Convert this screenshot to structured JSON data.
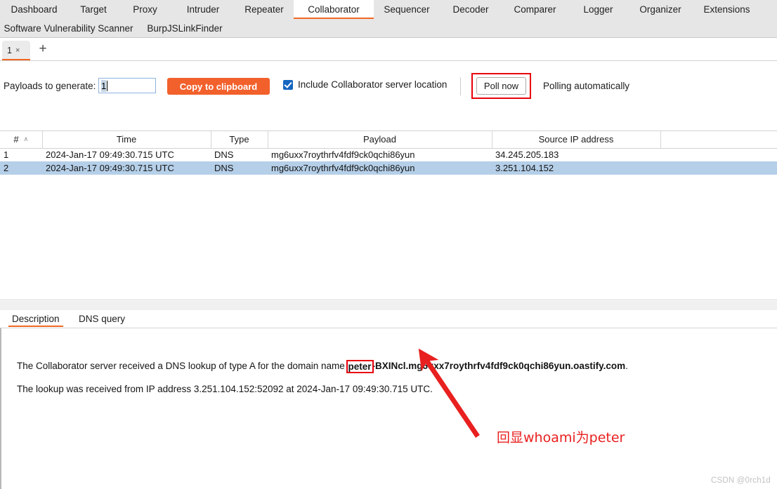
{
  "app": {
    "name": "Burp Suite Collaborator"
  },
  "main_tabs": {
    "row1": [
      {
        "label": "Dashboard",
        "active": false
      },
      {
        "label": "Target",
        "active": false
      },
      {
        "label": "Proxy",
        "active": false
      },
      {
        "label": "Intruder",
        "active": false
      },
      {
        "label": "Repeater",
        "active": false
      },
      {
        "label": "Collaborator",
        "active": true
      },
      {
        "label": "Sequencer",
        "active": false
      },
      {
        "label": "Decoder",
        "active": false
      },
      {
        "label": "Comparer",
        "active": false
      },
      {
        "label": "Logger",
        "active": false
      },
      {
        "label": "Organizer",
        "active": false
      },
      {
        "label": "Extensions",
        "active": false
      }
    ],
    "row2": [
      {
        "label": "Software Vulnerability Scanner",
        "active": false
      },
      {
        "label": "BurpJSLinkFinder",
        "active": false
      }
    ]
  },
  "subtabs": {
    "items": [
      {
        "label": "1",
        "close": "×",
        "active": true
      }
    ],
    "add_label": "+"
  },
  "toolbar": {
    "payloads_label": "Payloads to generate:",
    "payloads_value": "1",
    "payloads_placeholder": "",
    "copy_label": "Copy to clipboard",
    "include_location_label": "Include Collaborator server location",
    "include_location_checked": true,
    "poll_now_label": "Poll now",
    "polling_status": "Polling automatically",
    "accent_color": "#f2602c",
    "highlight_color": "#e8000c"
  },
  "table": {
    "columns": [
      {
        "key": "num",
        "label": "#",
        "sort": "∧"
      },
      {
        "key": "time",
        "label": "Time"
      },
      {
        "key": "type",
        "label": "Type"
      },
      {
        "key": "payload",
        "label": "Payload"
      },
      {
        "key": "ip",
        "label": "Source IP address"
      },
      {
        "key": "extra",
        "label": ""
      }
    ],
    "rows": [
      {
        "num": "1",
        "time": "2024-Jan-17 09:49:30.715 UTC",
        "type": "DNS",
        "payload": "mg6uxx7roythrfv4fdf9ck0qchi86yun",
        "ip": "34.245.205.183",
        "selected": false
      },
      {
        "num": "2",
        "time": "2024-Jan-17 09:49:30.715 UTC",
        "type": "DNS",
        "payload": "mg6uxx7roythrfv4fdf9ck0qchi86yun",
        "ip": "3.251.104.152",
        "selected": true
      }
    ],
    "selected_row_color": "#b5cfe8"
  },
  "detail": {
    "tabs": [
      {
        "label": "Description",
        "active": true
      },
      {
        "label": "DNS query",
        "active": false
      }
    ],
    "line1_prefix": "The Collaborator server received a DNS lookup of type A for the domain name ",
    "line1_highlight": "peter",
    "line1_domain_rest": "-BXINcl.mg6uxx7roythrfv4fdf9ck0qchi86yun.oastify.com",
    "line1_suffix": ".",
    "line2": "The lookup was received from IP address 3.251.104.152:52092 at 2024-Jan-17 09:49:30.715 UTC."
  },
  "annotation": {
    "text": "回显whoami为peter",
    "color": "#e8201f"
  },
  "watermark": {
    "text": "CSDN @0rch1d"
  }
}
